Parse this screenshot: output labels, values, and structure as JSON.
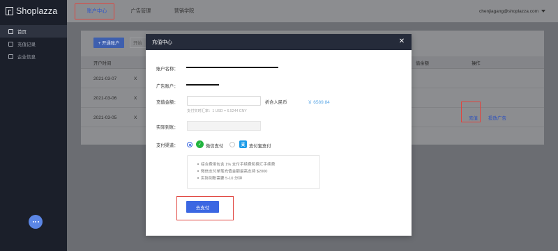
{
  "app": {
    "logo_text": "Shoplazza",
    "user_email": "chenjiagang@shoplazza.com"
  },
  "sidebar": {
    "items": [
      {
        "label": "首页",
        "icon": "home-icon",
        "active": true
      },
      {
        "label": "充值记录",
        "icon": "record-icon",
        "active": false
      },
      {
        "label": "企业信息",
        "icon": "company-icon",
        "active": false
      }
    ]
  },
  "topnav": {
    "items": [
      {
        "label": "账户中心",
        "active": true
      },
      {
        "label": "广告管理",
        "active": false
      },
      {
        "label": "营销学院",
        "active": false
      }
    ]
  },
  "content": {
    "open_account_button": "+ 开通账户",
    "secondary_button": "开始",
    "columns": {
      "open_time": "开户时间",
      "balance": "值余额",
      "actions": "操作"
    },
    "rows": [
      {
        "date": "2021-03-07",
        "prefix": "X",
        "actions": []
      },
      {
        "date": "2021-03-06",
        "prefix": "X",
        "actions": []
      },
      {
        "date": "2021-03-05",
        "prefix": "X",
        "actions": [
          "充值",
          "投放广告"
        ]
      }
    ]
  },
  "modal": {
    "title": "充值中心",
    "close_icon": "close-icon",
    "fields": {
      "account_name_label": "账户名称：",
      "ad_account_label": "广告账户：",
      "amount_label": "充值金额：",
      "amount_value": "",
      "cny_label": "折合人民币",
      "cny_value": "￥ 6589.84",
      "rate_note": "支付实时汇率：1 USD = 6.5244 CNY",
      "actual_label": "实际到账：",
      "actual_value": "",
      "channel_label": "支付渠道："
    },
    "channels": [
      {
        "label": "微信支付",
        "icon": "wechat-pay-icon",
        "selected": true
      },
      {
        "label": "支付宝支付",
        "icon": "alipay-icon",
        "selected": false
      }
    ],
    "notices": [
      "综合费用包含 1% 支付手续费和换汇手续费",
      "微信支付单笔充值金额最高支持 $2000",
      "实际到账需要 5-10 分钟"
    ],
    "pay_button": "去支付"
  },
  "colors": {
    "accent": "#3b67e2",
    "highlight": "#e0443e",
    "sidebar_bg": "#1b1f2a",
    "modal_header_bg": "#252b3a",
    "cny_value": "#5aa7e6"
  }
}
